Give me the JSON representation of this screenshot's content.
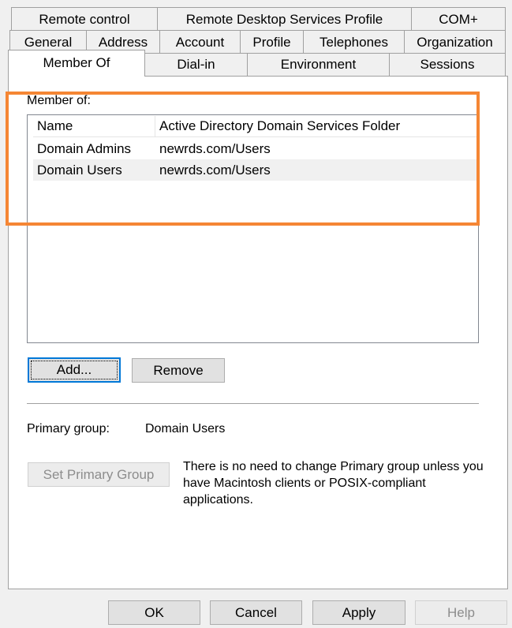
{
  "tabs": {
    "row1": [
      "Remote control",
      "Remote Desktop Services Profile",
      "COM+"
    ],
    "row2": [
      "General",
      "Address",
      "Account",
      "Profile",
      "Telephones",
      "Organization"
    ],
    "row3": [
      "Member Of",
      "Dial-in",
      "Environment",
      "Sessions"
    ]
  },
  "member_of": {
    "label": "Member of:",
    "columns": [
      "Name",
      "Active Directory Domain Services Folder"
    ],
    "rows": [
      {
        "name": "Domain Admins",
        "folder": "newrds.com/Users"
      },
      {
        "name": "Domain Users",
        "folder": "newrds.com/Users"
      }
    ]
  },
  "buttons": {
    "add": "Add...",
    "remove": "Remove",
    "set_primary": "Set Primary Group"
  },
  "primary_group": {
    "label": "Primary group:",
    "value": "Domain Users"
  },
  "note": "There is no need to change Primary group unless you have Macintosh clients or POSIX-compliant applications.",
  "dialog_buttons": {
    "ok": "OK",
    "cancel": "Cancel",
    "apply": "Apply",
    "help": "Help"
  },
  "colors": {
    "highlight": "#f58634",
    "focus": "#0078d7"
  }
}
